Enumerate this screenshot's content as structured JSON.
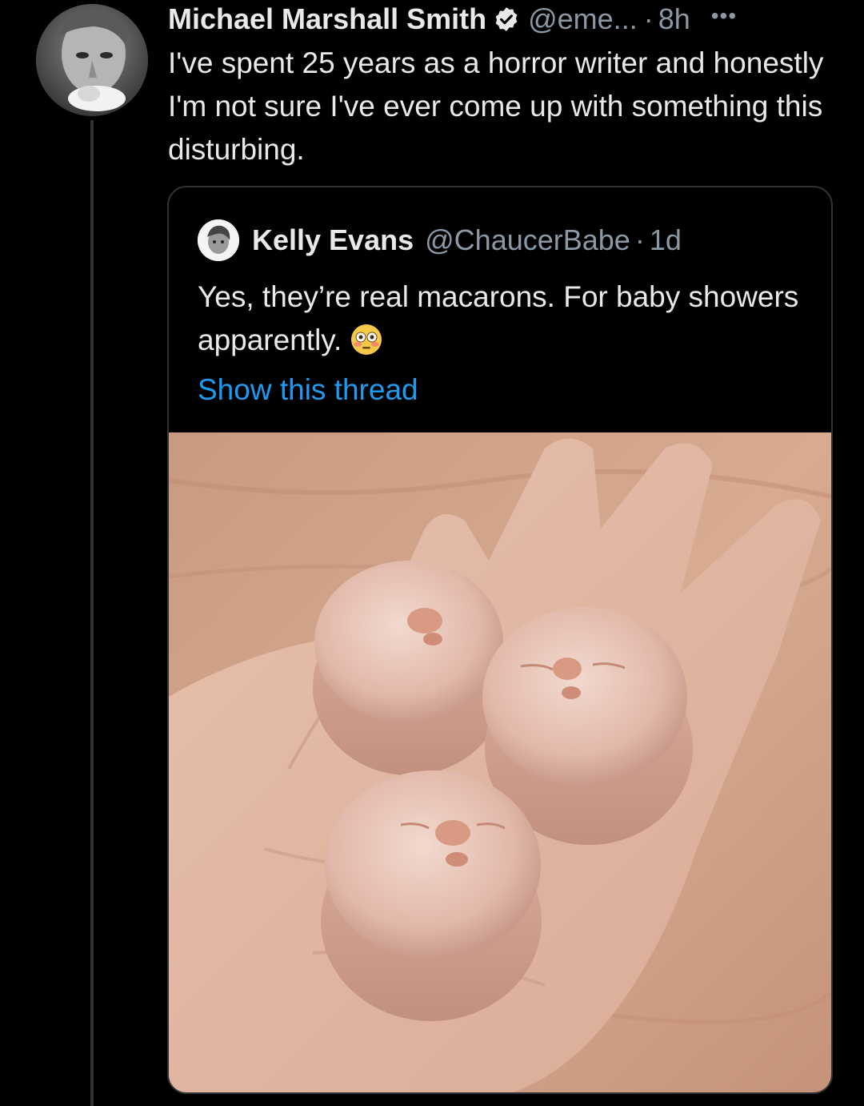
{
  "tweet": {
    "author_name": "Michael Marshall Smith",
    "handle": "@eme...",
    "separator": "·",
    "timestamp": "8h",
    "more_icon": "more-horizontal-icon",
    "verified_icon": "verified-badge-icon",
    "text": "I've spent 25 years as a horror writer and honestly I'm not sure I've ever come up with something this disturbing."
  },
  "quoted_tweet": {
    "author_name": "Kelly Evans",
    "handle": "@ChaucerBabe",
    "separator": "·",
    "timestamp": "1d",
    "text": "Yes, they’re real macarons.  For baby showers apparently.",
    "emoji_icon": "flushed-face-icon",
    "show_thread_label": "Show this thread"
  },
  "colors": {
    "background": "#000000",
    "text_primary": "#e7e9ea",
    "text_secondary": "#8b98a5",
    "link": "#1d9bf0",
    "border": "#2f3336",
    "verified": "#e7e9ea"
  }
}
